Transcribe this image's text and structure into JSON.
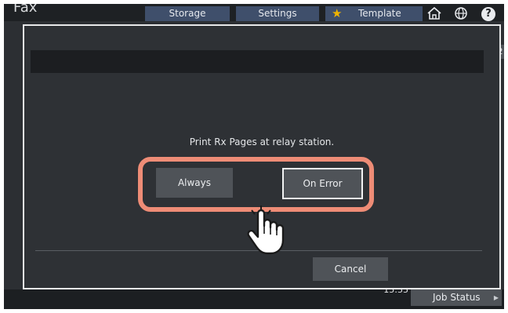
{
  "app": {
    "title": "Fax"
  },
  "tabs": {
    "storage": "Storage",
    "settings": "Settings",
    "template": "Template"
  },
  "icons": {
    "star": "star-icon",
    "home": "home-icon",
    "globe": "globe-icon",
    "help": "help-icon",
    "hand": "pointer-hand-icon"
  },
  "dialog": {
    "message": "Print Rx Pages at relay station.",
    "always_label": "Always",
    "on_error_label": "On Error",
    "cancel_label": "Cancel",
    "selected": "On Error"
  },
  "status": {
    "time": "15:55",
    "job_status_label": "Job Status"
  },
  "colors": {
    "highlight": "#ee8c76",
    "tab_blue": "#3f4f6b",
    "star": "#f0b400"
  }
}
